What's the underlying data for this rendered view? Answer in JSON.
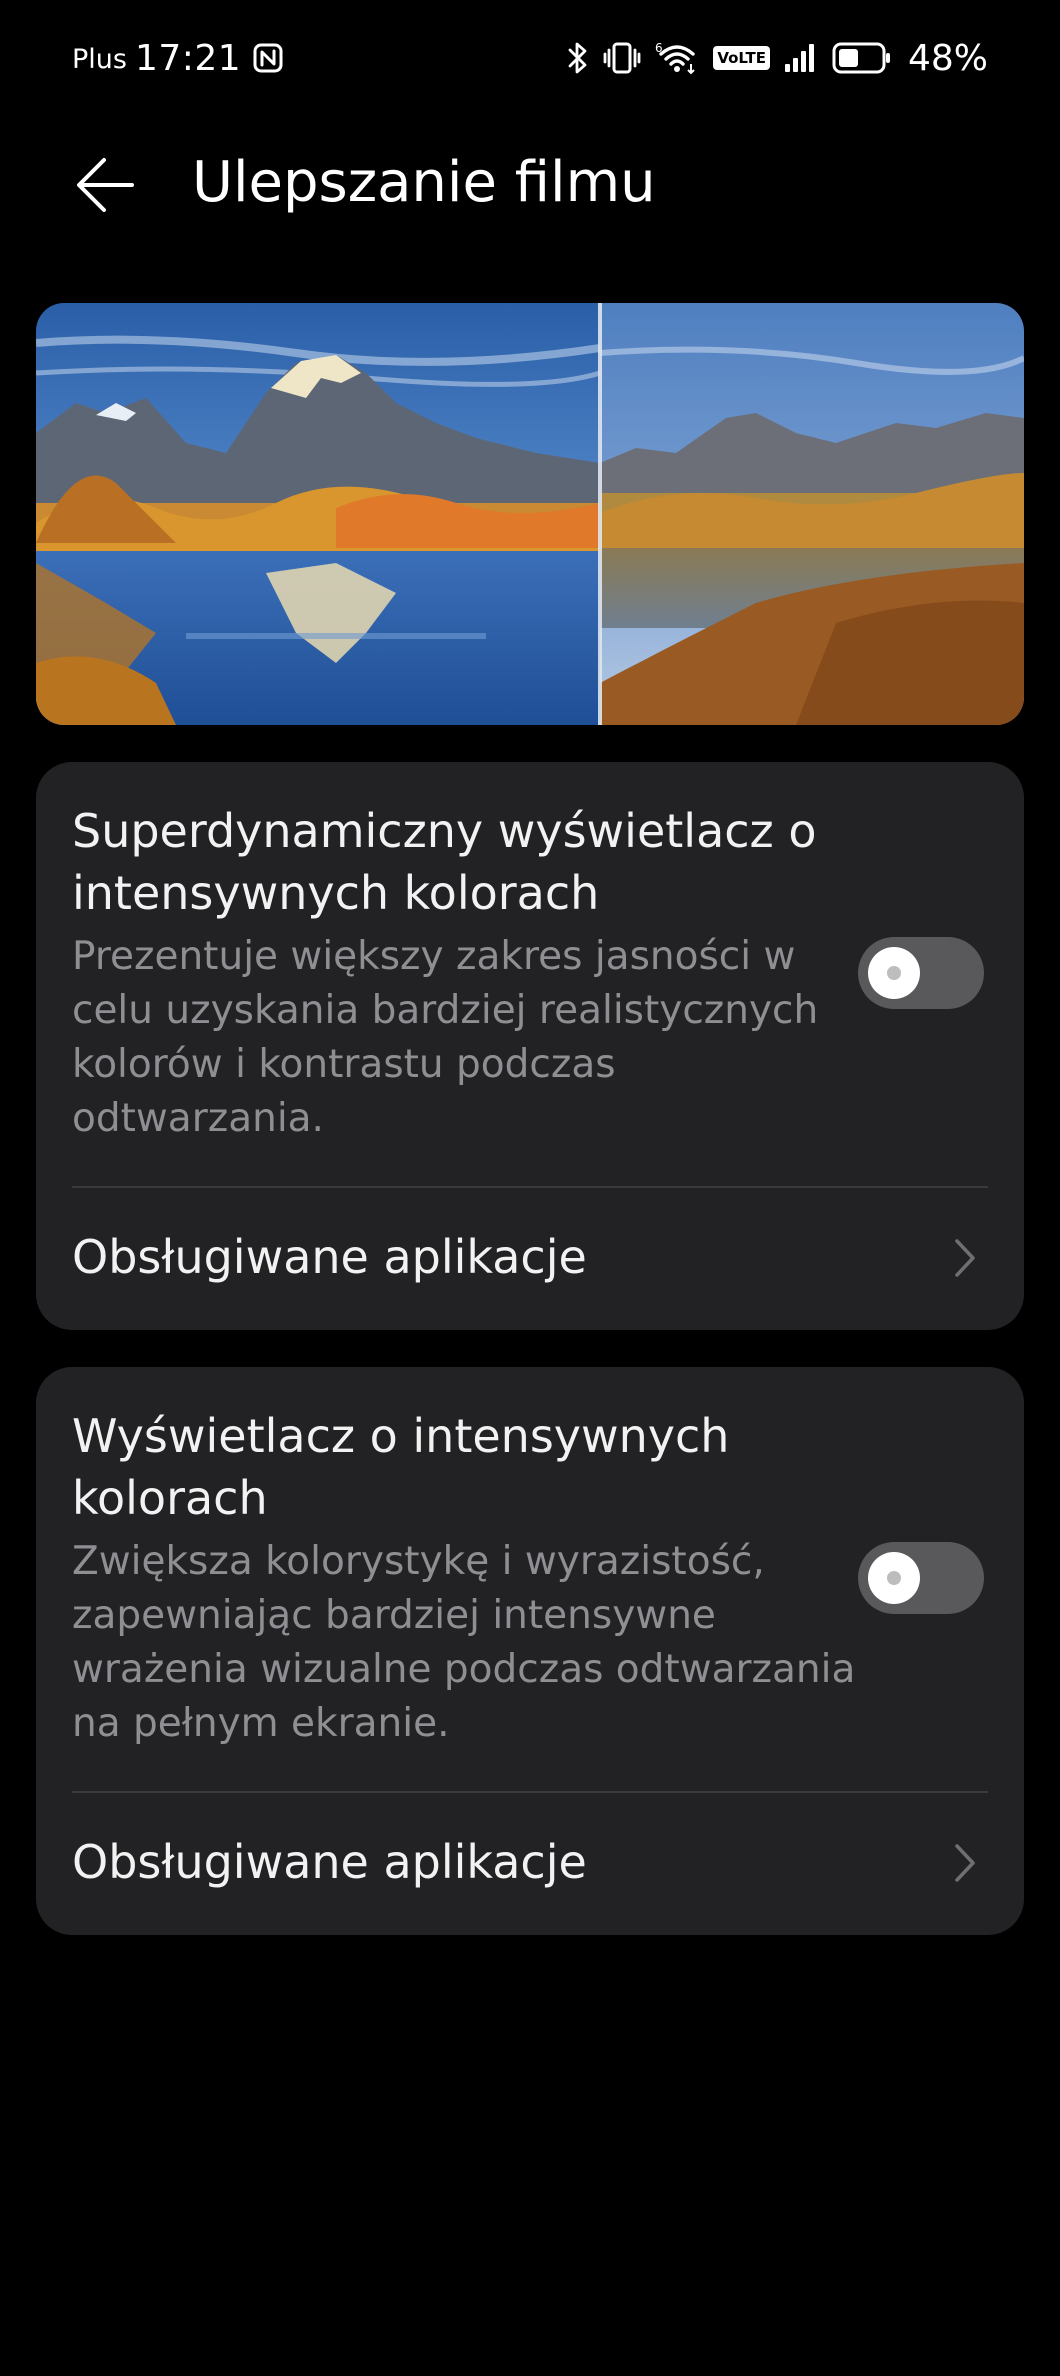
{
  "status_bar": {
    "carrier": "Plus",
    "time": "17:21",
    "network_type": "6",
    "volte": "VoLTE",
    "battery_percent": "48%",
    "battery_level": 0.48,
    "icons": [
      "nfc-icon",
      "bluetooth-icon",
      "vibrate-icon",
      "wifi-icon",
      "volte-icon",
      "signal-icon",
      "battery-icon"
    ]
  },
  "header": {
    "back_icon": "arrow-left-icon",
    "title": "Ulepszanie filmu"
  },
  "preview": {
    "description_icon": "before-after-landscape-image"
  },
  "settings": [
    {
      "title": "Superdynamiczny wyświetlacz o intensywnych kolorach",
      "description": "Prezentuje większy zakres jasności w celu uzyskania bardziej realistycznych kolorów i kontrastu podczas odtwarzania.",
      "enabled": false,
      "link_label": "Obsługiwane aplikacje"
    },
    {
      "title": "Wyświetlacz o intensywnych kolorach",
      "description": "Zwiększa kolorystykę i wyrazistość, zapewniając bardziej intensywne wrażenia wizualne podczas odtwarzania na pełnym ekranie.",
      "enabled": false,
      "link_label": "Obsługiwane aplikacje"
    }
  ],
  "colors": {
    "background": "#000000",
    "card": "#222224",
    "text_primary": "#f2f2f2",
    "text_secondary": "#8e8e93",
    "toggle_off": "#59595c",
    "divider": "#3a3a3c"
  }
}
